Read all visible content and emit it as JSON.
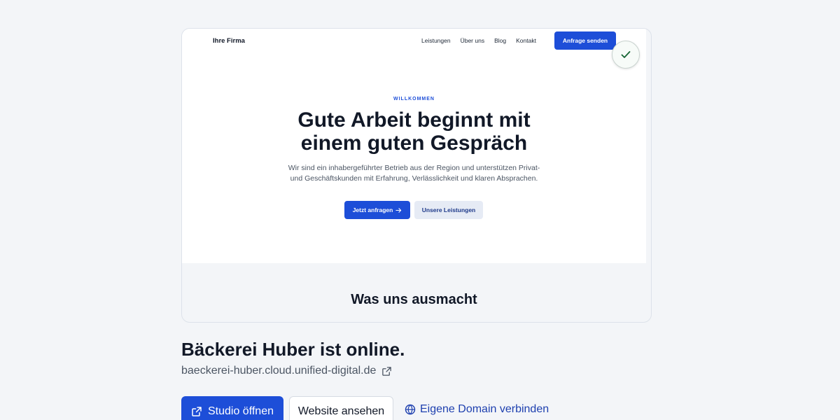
{
  "preview": {
    "site": {
      "brand": "Ihre Firma",
      "nav": [
        "Leistungen",
        "Über uns",
        "Blog",
        "Kontakt"
      ],
      "cta_label": "Anfrage senden",
      "eyebrow": "WILLKOMMEN",
      "hero_title": "Gute Arbeit beginnt mit\neinem guten Gespräch",
      "hero_text": "Wir sind ein inhabergeführter Betrieb aus der Region und unterstützen Privat- und Geschäftskunden mit Erfahrung, Verlässlichkeit und klaren Absprachen.",
      "primary_button": "Jetzt anfragen",
      "secondary_button": "Unsere Leistungen"
    },
    "section_title": "Was uns ausmacht"
  },
  "status": {
    "title": "Bäckerei Huber ist online.",
    "url": "baeckerei-huber.cloud.unified-digital.de"
  },
  "actions": {
    "studio_label": "Studio öffnen",
    "website_label": "Website ansehen",
    "domain_label": "Eigene Domain verbinden"
  },
  "icons": {
    "check": "check-icon",
    "external_link": "external-link-icon",
    "arrow_right": "arrow-right-icon",
    "globe": "globe-icon"
  },
  "colors": {
    "accent": "#1d4ed8",
    "success": "#166534",
    "background": "#f3f5f8"
  }
}
